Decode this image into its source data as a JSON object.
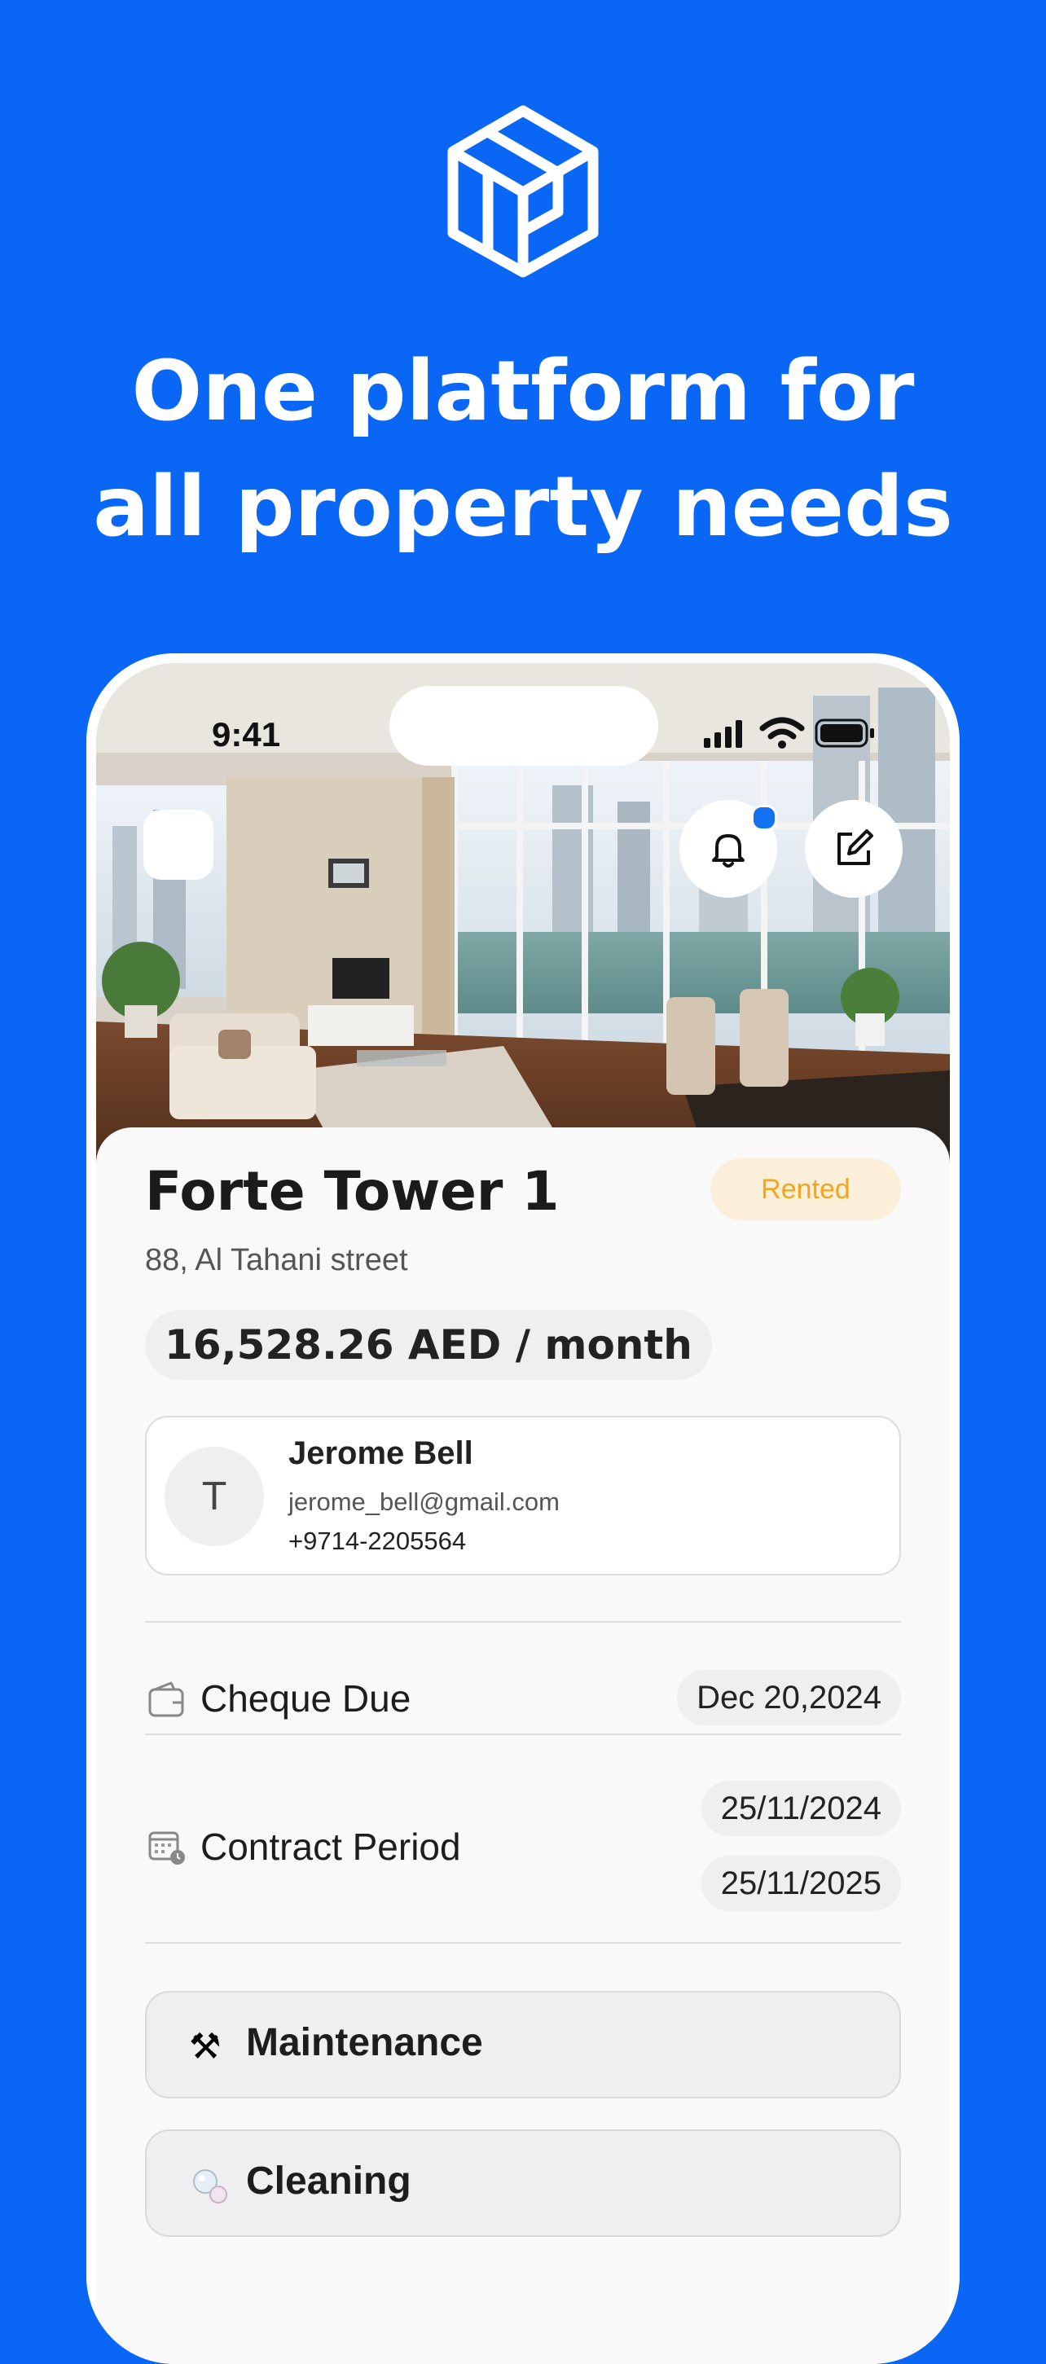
{
  "headline": {
    "line1": "One platform for",
    "line2": "all property needs"
  },
  "status_bar": {
    "time": "9:41"
  },
  "property": {
    "name": "Forte Tower 1",
    "status": "Rented",
    "address": "88, Al Tahani street",
    "price": "16,528.26 AED / month"
  },
  "tenant": {
    "initial": "T",
    "name": "Jerome Bell",
    "email": "jerome_bell@gmail.com",
    "phone": "+9714-2205564"
  },
  "cheque": {
    "label": "Cheque Due",
    "date": "Dec 20,2024"
  },
  "contract": {
    "label": "Contract Period",
    "start": "25/11/2024",
    "end": "25/11/2025"
  },
  "actions": [
    {
      "label": "Maintenance",
      "icon": "tools-icon"
    },
    {
      "label": "Cleaning",
      "icon": "bubbles-icon"
    }
  ],
  "colors": {
    "brand_blue": "#0A66F5",
    "rented_badge_bg": "#FBEFD9",
    "rented_badge_text": "#F3A51D"
  }
}
